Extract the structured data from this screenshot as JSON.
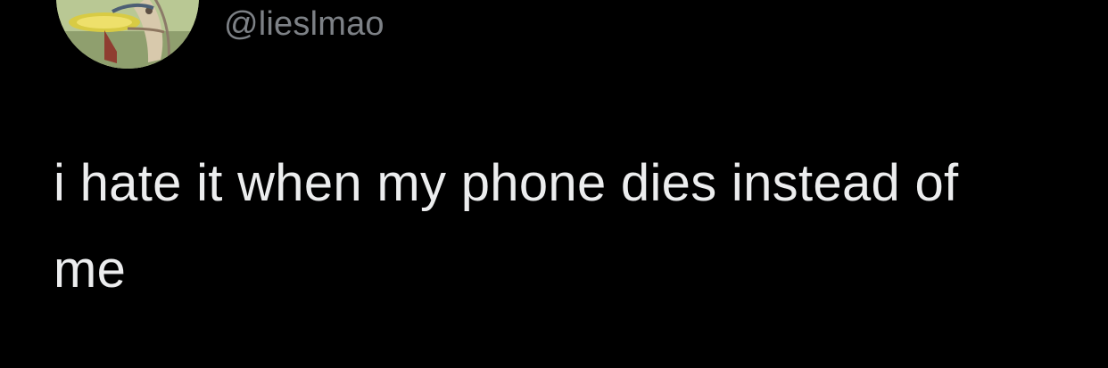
{
  "profile": {
    "avatar_icon": "cartoon-avatar-icon",
    "handle": "@lieslmao"
  },
  "tweet": {
    "text": "i hate it when my phone dies instead of me"
  },
  "colors": {
    "background": "#000000",
    "handle": "#7d8186",
    "text": "#ecedee"
  }
}
